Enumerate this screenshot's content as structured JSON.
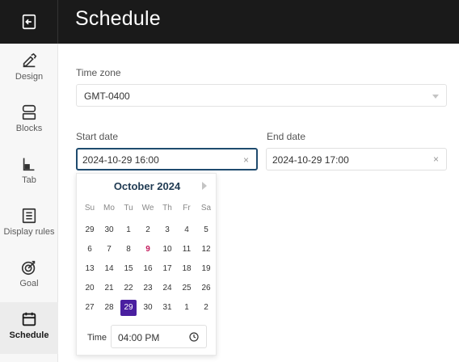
{
  "header": {
    "title": "Schedule",
    "back_icon": "exit-icon"
  },
  "sidebar": {
    "items": [
      {
        "label": "Design",
        "icon": "paint-icon"
      },
      {
        "label": "Blocks",
        "icon": "blocks-icon"
      },
      {
        "label": "Tab",
        "icon": "tab-icon"
      },
      {
        "label": "Display rules",
        "icon": "rules-icon"
      },
      {
        "label": "Goal",
        "icon": "target-icon"
      },
      {
        "label": "Schedule",
        "icon": "calendar-icon",
        "active": true
      }
    ]
  },
  "form": {
    "timezone": {
      "label": "Time zone",
      "value": "GMT-0400"
    },
    "start": {
      "label": "Start date",
      "value": "2024-10-29 16:00",
      "clear": "×"
    },
    "end": {
      "label": "End date",
      "value": "2024-10-29 17:00",
      "clear": "×"
    }
  },
  "calendar": {
    "month": "October 2024",
    "weekdays": [
      "Su",
      "Mo",
      "Tu",
      "We",
      "Th",
      "Fr",
      "Sa"
    ],
    "weeks": [
      [
        "29",
        "30",
        "1",
        "2",
        "3",
        "4",
        "5"
      ],
      [
        "6",
        "7",
        "8",
        "9",
        "10",
        "11",
        "12"
      ],
      [
        "13",
        "14",
        "15",
        "16",
        "17",
        "18",
        "19"
      ],
      [
        "20",
        "21",
        "22",
        "23",
        "24",
        "25",
        "26"
      ],
      [
        "27",
        "28",
        "29",
        "30",
        "31",
        "1",
        "2"
      ]
    ],
    "today": "9",
    "selected": "29",
    "time_label": "Time",
    "time_value": "04:00 PM",
    "colors": {
      "selected": "#4a1fa0",
      "today": "#c2185b"
    }
  }
}
